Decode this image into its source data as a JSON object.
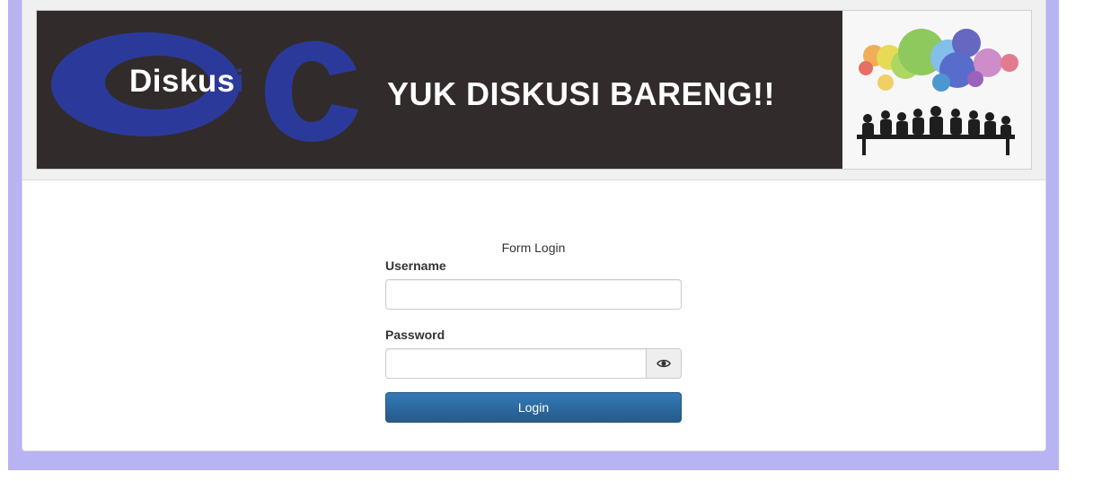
{
  "colors": {
    "page_background": "#b8b3f3",
    "banner_background": "#322b2b",
    "logo_blue": "#2b3a9a",
    "button_primary": "#337ab7"
  },
  "banner": {
    "logo_text_main": "Diskus",
    "logo_text_accent": "i",
    "title": "YUK DISKUSI BARENG!!"
  },
  "login_form": {
    "title": "Form Login",
    "username_label": "Username",
    "username_value": "",
    "password_label": "Password",
    "password_value": "",
    "toggle_icon": "eye-icon",
    "submit_label": "Login"
  }
}
